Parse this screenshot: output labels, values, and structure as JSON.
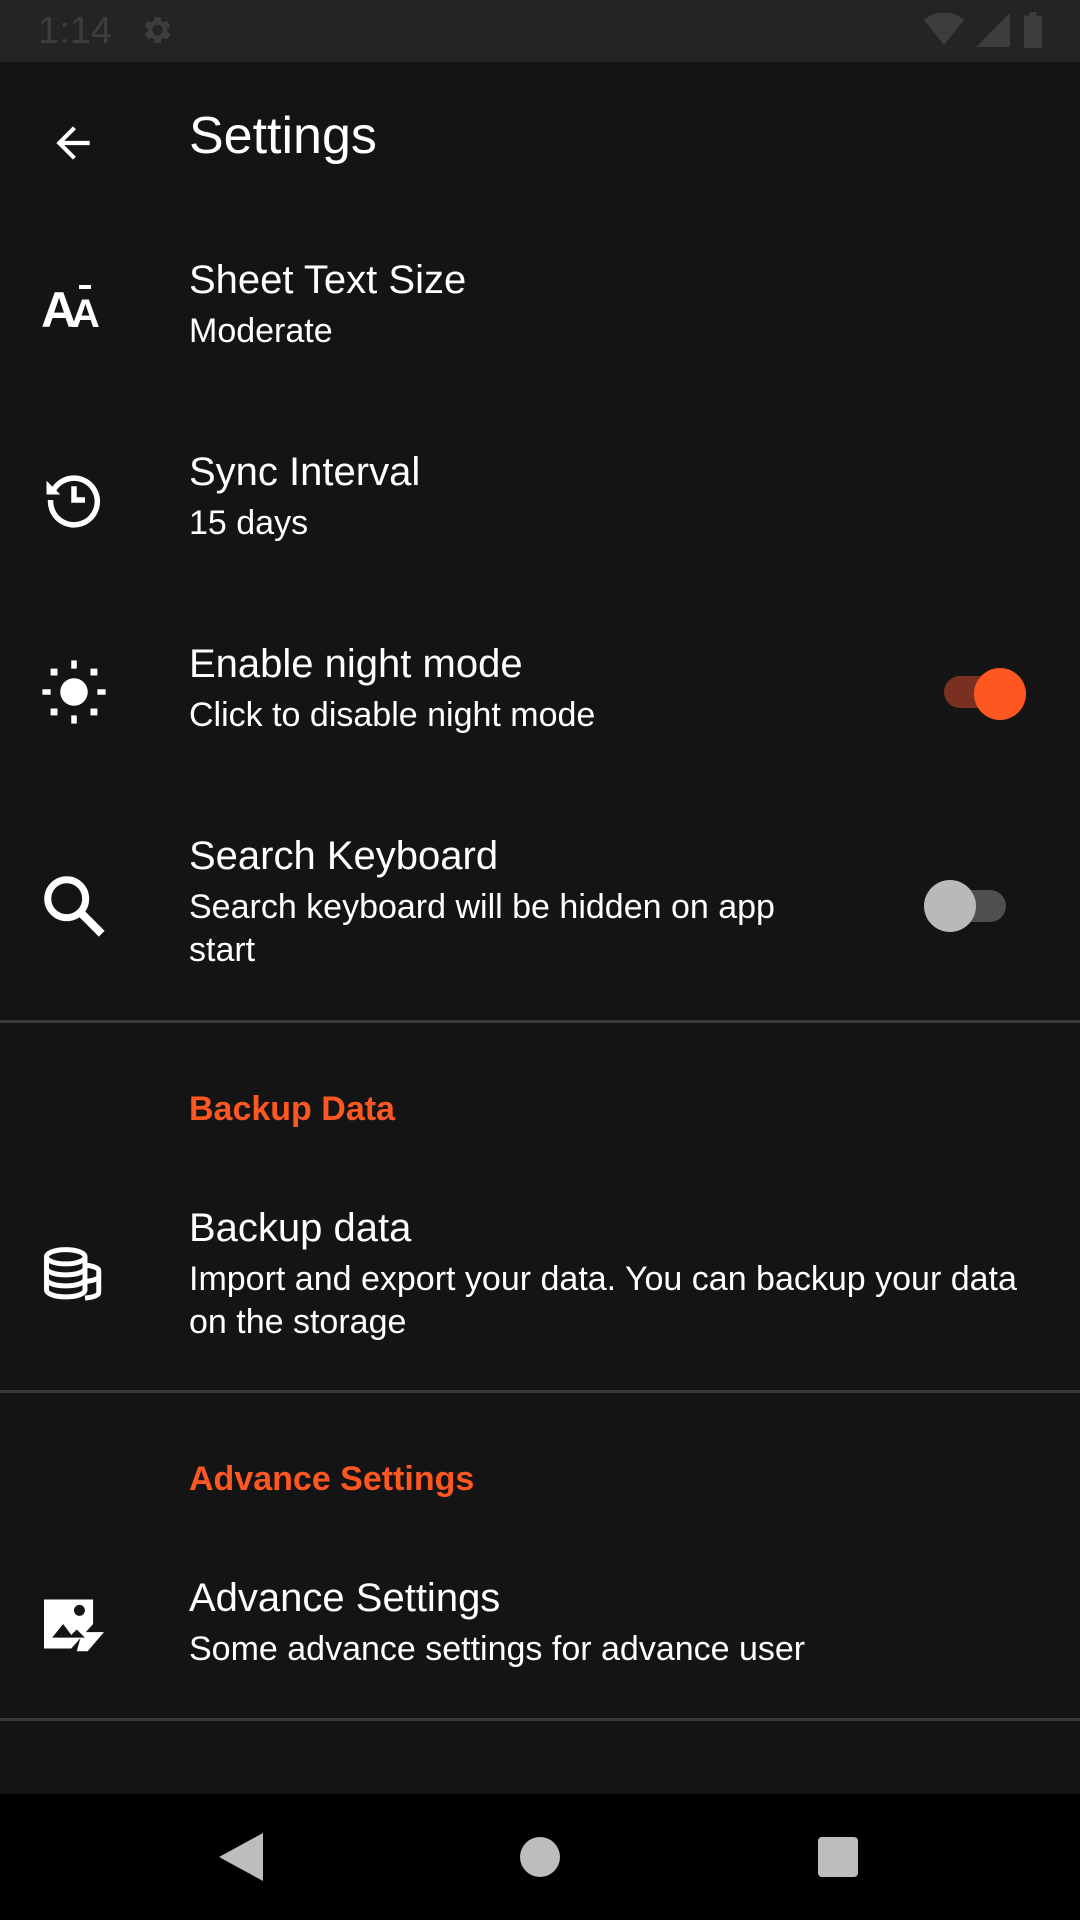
{
  "status_bar": {
    "time": "1:14"
  },
  "app_bar": {
    "title": "Settings"
  },
  "prefs": [
    {
      "title": "Sheet Text Size",
      "summary": "Moderate"
    },
    {
      "title": "Sync Interval",
      "summary": "15 days"
    },
    {
      "title": "Enable night mode",
      "summary": "Click to disable night mode",
      "switch_on": true
    },
    {
      "title": "Search Keyboard",
      "summary": "Search keyboard will be hidden on app start",
      "switch_on": false
    }
  ],
  "backup": {
    "category": "Backup Data",
    "title": "Backup data",
    "summary": "Import and export your data. You can backup your data on the storage"
  },
  "advance": {
    "category": "Advance Settings",
    "title": "Advance Settings",
    "summary": "Some advance settings for advance user"
  },
  "colors": {
    "accent": "#ff5722",
    "background": "#141414",
    "status_bar": "#242424",
    "nav_bar": "#000000"
  },
  "icons": [
    "back-arrow-icon",
    "text-size-icon",
    "history-icon",
    "brightness-icon",
    "search-icon",
    "database-icon",
    "photo-settings-icon"
  ]
}
